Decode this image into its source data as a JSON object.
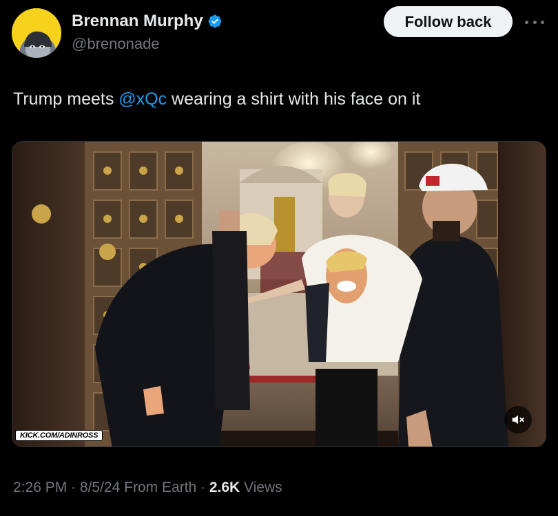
{
  "author": {
    "display_name": "Brennan Murphy",
    "handle": "@brenonade",
    "verified": true,
    "avatar_bg": "#f6d21c"
  },
  "follow_button": {
    "label": "Follow back"
  },
  "more_menu": {
    "icon": "more-horizontal-icon"
  },
  "tweet": {
    "text_before": "Trump meets ",
    "mention": "@xQc",
    "text_after": " wearing a shirt with his face on it"
  },
  "media": {
    "watermark": "KICK.COM/ADINROSS",
    "mute_icon": "volume-muted-icon"
  },
  "meta": {
    "time": "2:26 PM",
    "sep1": " · ",
    "date": "8/5/24",
    "source": " From Earth",
    "sep2": " · ",
    "views_count": "2.6K",
    "views_label": " Views"
  },
  "colors": {
    "background": "#000000",
    "text": "#e7e9ea",
    "secondary": "#71767b",
    "link": "#1d9bf0",
    "button_bg": "#eff3f4"
  }
}
